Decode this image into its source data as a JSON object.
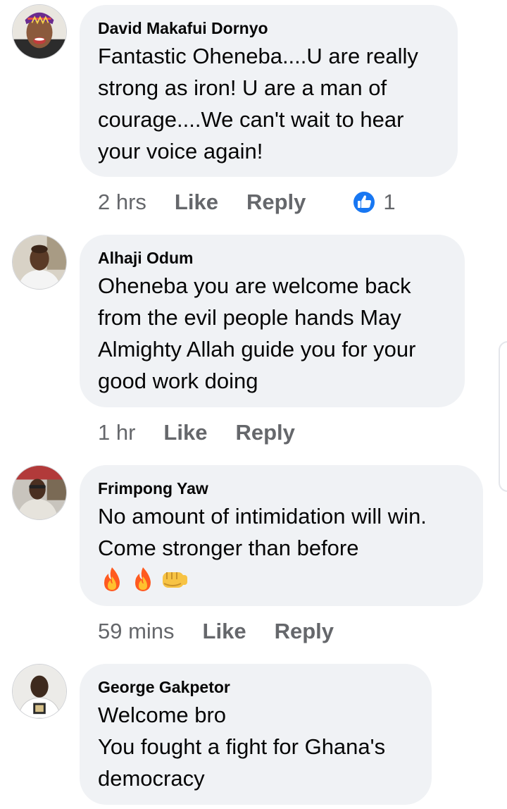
{
  "comments": [
    {
      "author": "David Makafui Dornyo",
      "text_lines": [
        "Fantastic Oheneba....U are really",
        "strong as iron! U are a man of",
        "courage....We can't wait to hear",
        "your voice again!"
      ],
      "time": "2 hrs",
      "like_label": "Like",
      "reply_label": "Reply",
      "reaction_count": "1",
      "reaction_icon": "thumbs-up-icon"
    },
    {
      "author": "Alhaji Odum",
      "text_lines": [
        "Oheneba you are welcome back",
        "from the evil people hands May",
        "Almighty Allah guide you for your",
        "good work doing"
      ],
      "time": "1 hr",
      "like_label": "Like",
      "reply_label": "Reply"
    },
    {
      "author": "Frimpong Yaw",
      "text_lines": [
        "No amount of intimidation will win.",
        "Come stronger than before"
      ],
      "emojis": [
        "fire-emoji",
        "fire-emoji",
        "fist-emoji"
      ],
      "time": "59 mins",
      "like_label": "Like",
      "reply_label": "Reply"
    },
    {
      "author": "George Gakpetor",
      "text_lines": [
        "Welcome bro",
        "You fought a fight for Ghana's",
        "democracy"
      ]
    }
  ],
  "colors": {
    "bubble": "#f0f2f5",
    "meta_text": "#65676b",
    "like_reaction": "#1877f2",
    "body_text": "#050505"
  }
}
